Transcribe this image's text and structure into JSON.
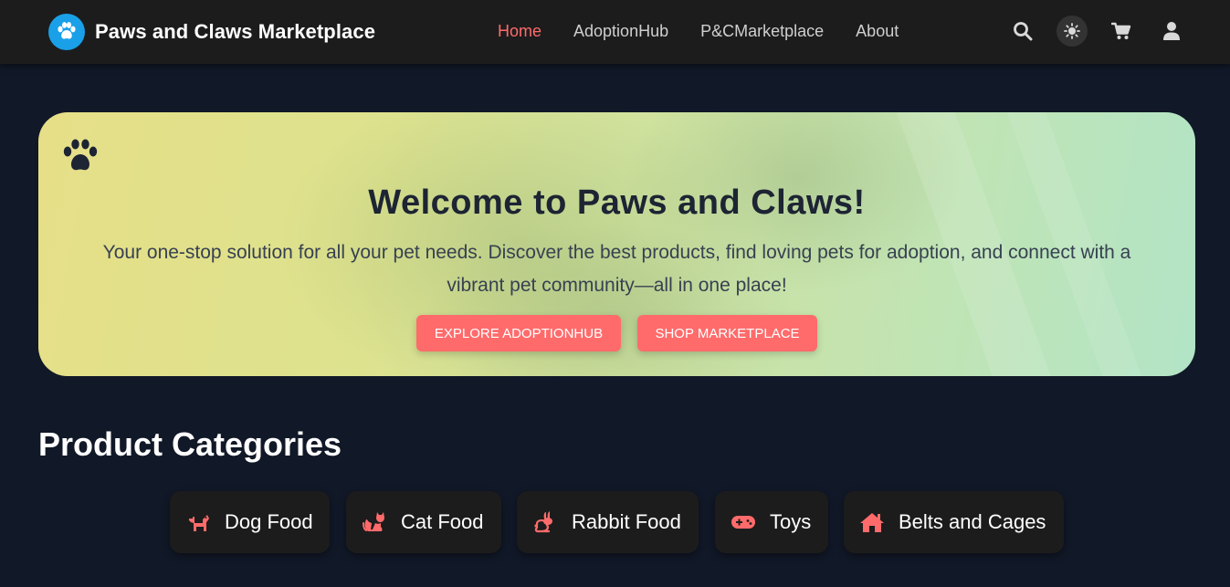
{
  "brand": {
    "name": "Paws and Claws Marketplace"
  },
  "nav": {
    "links": [
      {
        "label": "Home",
        "active": true
      },
      {
        "label": "AdoptionHub",
        "active": false
      },
      {
        "label": "P&CMarketplace",
        "active": false
      },
      {
        "label": "About",
        "active": false
      }
    ],
    "icons": [
      "search-icon",
      "sun-icon",
      "cart-icon",
      "user-icon"
    ]
  },
  "hero": {
    "title": "Welcome to Paws and Claws!",
    "subtitle": "Your one-stop solution for all your pet needs. Discover the best products, find loving pets for adoption, and connect with a vibrant pet community—all in one place!",
    "buttons": {
      "adopt": "Explore AdoptionHub",
      "shop": "Shop Marketplace"
    }
  },
  "categories": {
    "title": "Product Categories",
    "items": [
      {
        "label": "Dog Food",
        "icon": "dog-icon"
      },
      {
        "label": "Cat Food",
        "icon": "cat-icon"
      },
      {
        "label": "Rabbit Food",
        "icon": "rabbit-icon"
      },
      {
        "label": "Toys",
        "icon": "gamepad-icon"
      },
      {
        "label": "Belts and Cages",
        "icon": "house-icon"
      }
    ]
  },
  "colors": {
    "accent": "#ff6b6b",
    "background": "#111827",
    "navbar": "#1c1c1c",
    "logo": "#1aa0e8"
  }
}
